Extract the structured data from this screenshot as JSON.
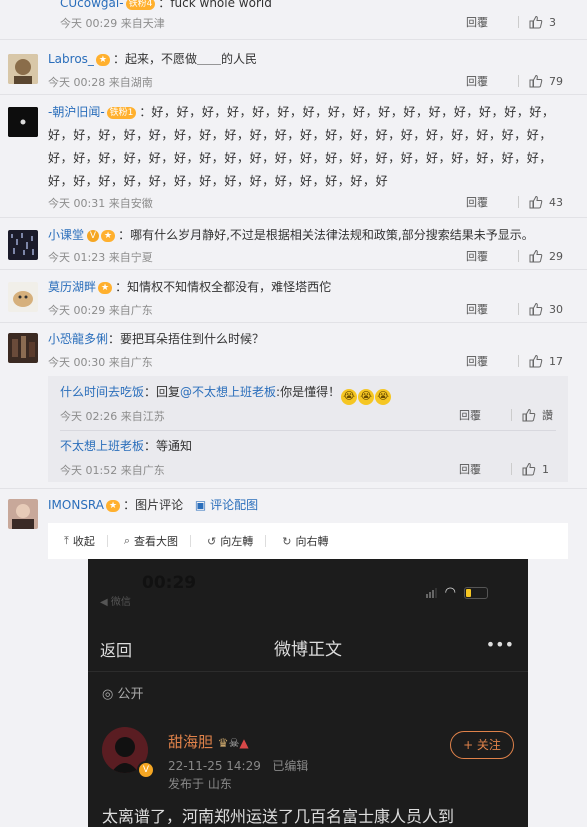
{
  "comments": [
    {
      "name": "CUcowgal-",
      "badge": "铁粉4",
      "sep": "：",
      "text": "fuck whole world",
      "time": "今天 00:29",
      "loc": "来自天津",
      "reply": "回覆",
      "likes": "3"
    },
    {
      "name": "Labros_",
      "badge": "",
      "sep": "：",
      "text": "起来，不愿做＿＿的人民",
      "time": "今天 00:28",
      "loc": "来自湖南",
      "reply": "回覆",
      "likes": "79"
    },
    {
      "name": "-朝沪旧闻-",
      "badge": "铁粉1",
      "sep": "：",
      "text": "好，好，好，好，好，好，好，好，好，好，好，好，好，好，好，好，好，好，好，好，好，好，好，好，好，好，好，好，好，好，好，好，好，好，好，好，好，好，好，好，好，好，好，好，好，好，好，好，好，好，好，好，好，好，好，好，好，好，好，好，好，好，好，好，好，好，好，好，好，好",
      "time": "今天 00:31",
      "loc": "来自安徽",
      "reply": "回覆",
      "likes": "43"
    },
    {
      "name": "小课堂",
      "badge": "",
      "sep": "：",
      "text": "哪有什么岁月静好,不过是根据相关法律法规和政策,部分搜索结果未予显示。",
      "time": "今天 01:23",
      "loc": "来自宁夏",
      "reply": "回覆",
      "likes": "29"
    },
    {
      "name": "莫历湖畔",
      "badge": "",
      "sep": "：",
      "text": "知情权不知情权全都没有，难怪塔西佗",
      "time": "今天 00:29",
      "loc": "来自广东",
      "reply": "回覆",
      "likes": "30"
    },
    {
      "name": "小恐龍多俐",
      "badge": "",
      "sep": "：",
      "text": "要把耳朵捂住到什么时候？",
      "time": "今天 00:30",
      "loc": "来自广东",
      "reply": "回覆",
      "likes": "17"
    }
  ],
  "subreplies": [
    {
      "name": "什么时间去吃饭",
      "text_prefix": "：回复",
      "mention": "@不太想上班老板",
      "text": ":你是懂得！",
      "time": "今天 02:26",
      "loc": "来自江苏",
      "reply": "回覆",
      "likes": "讚"
    },
    {
      "name": "不太想上班老板",
      "text_prefix": "：",
      "mention": "",
      "text": "等通知",
      "time": "今天 01:52",
      "loc": "来自广东",
      "reply": "回覆",
      "likes": "1"
    }
  ],
  "image_comment": {
    "name": "IMONSRA",
    "text": "：图片评论",
    "link": "评论配图"
  },
  "pic_toolbar": {
    "collapse": "收起",
    "view_large": "查看大图",
    "rotate_left": "向左轉",
    "rotate_right": "向右轉"
  },
  "phone": {
    "time": "00:29",
    "carrier": "◀ 微信",
    "back": "返回",
    "title": "微博正文",
    "more": "•••",
    "visibility": "公开",
    "author": "甜海胆",
    "follow": "+ 关注",
    "post_time": "22-11-25 14:29",
    "edited": "已编辑",
    "posted_from": "发布于 山东",
    "body": "太离谱了，河南郑州运送了几百名富士康人员人到"
  }
}
